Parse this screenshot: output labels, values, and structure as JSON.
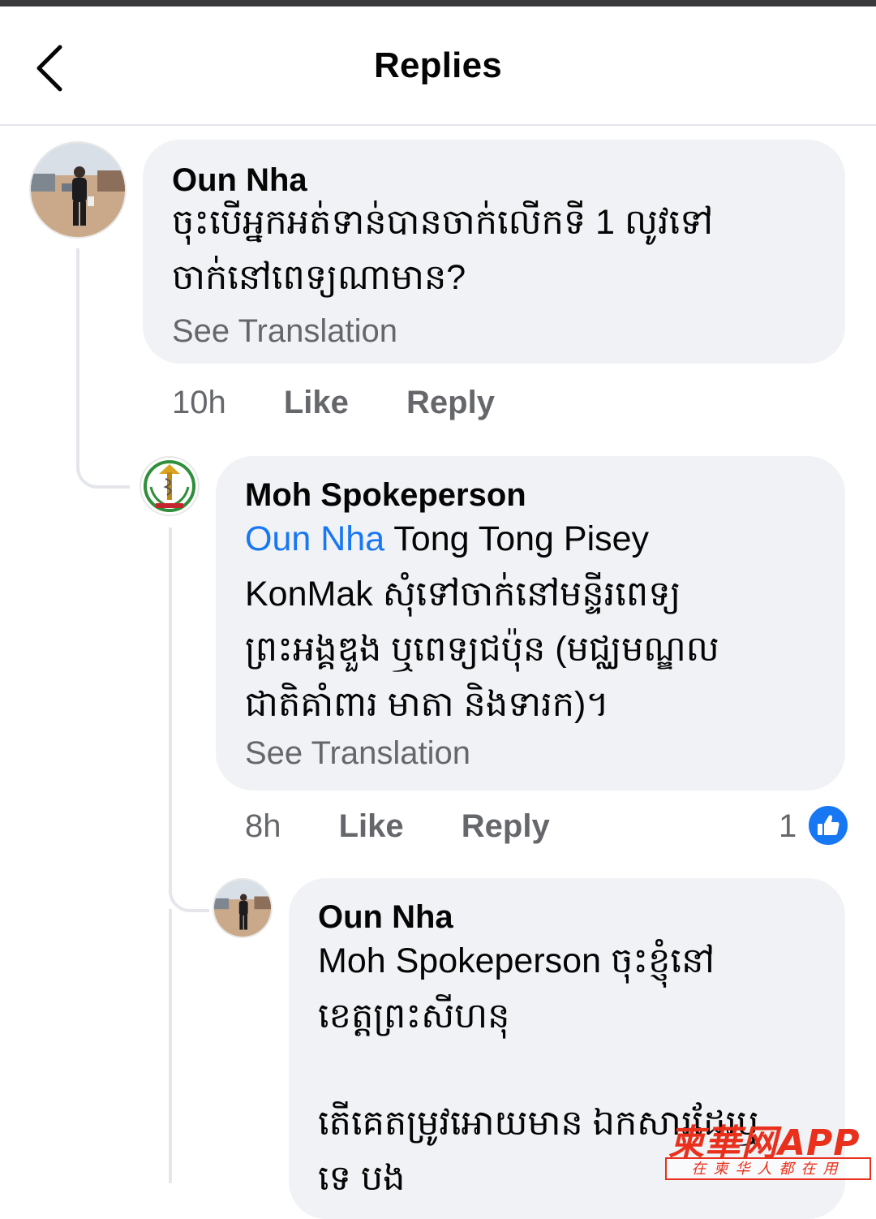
{
  "header": {
    "title": "Replies",
    "back_icon": "chevron-left-icon"
  },
  "comments": [
    {
      "author": "Oun Nha",
      "text_lines": [
        "ចុះបើអ្នកអត់ទាន់បានចាក់លើកទី 1 លូវទៅ",
        "ចាក់នៅពេទ្យណាមាន?"
      ],
      "see_translation": "See Translation",
      "time": "10h",
      "like": "Like",
      "reply": "Reply"
    },
    {
      "author": "Moh Spokeperson",
      "mention": "Oun Nha",
      "line1_rest": " Tong Tong Pisey",
      "text_lines": [
        "KonMak សុំទៅចាក់នៅមន្ទីរពេទ្យ",
        "ព្រះអង្គឌួង ឬពេទ្យជប៉ុន (មជ្ឈមណ្ឌល",
        "ជាតិគាំពារ មាតា និងទារក)។"
      ],
      "see_translation": "See Translation",
      "time": "8h",
      "like": "Like",
      "reply": "Reply",
      "reaction_count": "1",
      "reaction_icon": "thumbs-up-icon",
      "reaction_color": "#1877f2"
    },
    {
      "author": "Oun Nha",
      "text_lines": [
        "Moh Spokeperson ចុះខ្ញុំនៅ",
        "ខេត្តព្រះសីហនុ",
        "",
        "តើគេតម្រូវអោយមាន ឯកសារដែរឬ",
        "ទេ បង"
      ]
    }
  ],
  "watermark": {
    "main": "柬華网APP",
    "sub": "在柬华人都在用",
    "color": "#e8301c"
  },
  "colors": {
    "bubble": "#f0f2f5",
    "mention": "#1877f2",
    "meta": "#65676b"
  }
}
